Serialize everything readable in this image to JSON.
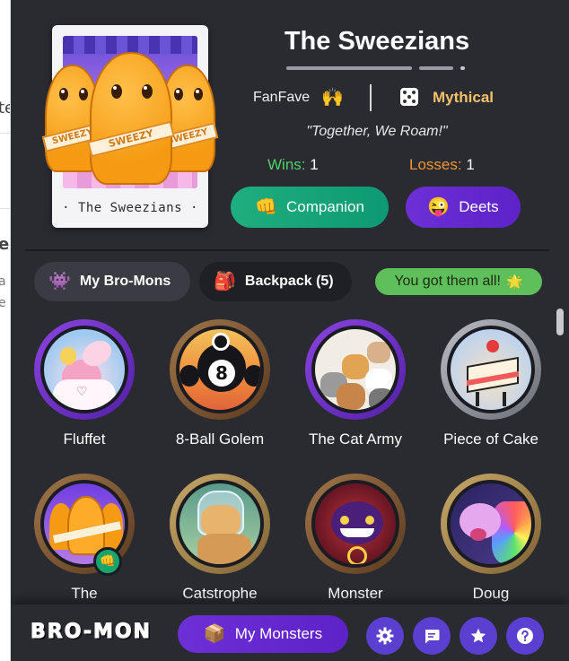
{
  "background_page": {
    "fragments": [
      "te",
      "e",
      "a",
      "e"
    ]
  },
  "header": {
    "card_caption": "· The Sweezians ·",
    "card_band_text": "SWEEZY",
    "team_name": "The Sweezians",
    "fan_label": "FanFave",
    "fan_icon": "raised-hands-emoji",
    "rarity_icon": "dice-icon",
    "rarity": "Mythical",
    "motto": "\"Together, We Roam!\"",
    "wins_label": "Wins:",
    "wins_value": "1",
    "losses_label": "Losses:",
    "losses_value": "1",
    "companion_button": "Companion",
    "deets_button": "Deets"
  },
  "tabs": {
    "my_bromons": "My Bro-Mons",
    "backpack": "Backpack (5)",
    "toast": "You got them all!"
  },
  "monsters": [
    {
      "name": "Fluffet",
      "ring": "purple"
    },
    {
      "name": "8-Ball Golem",
      "ring": "bronze"
    },
    {
      "name": "The Cat Army",
      "ring": "purple"
    },
    {
      "name": "Piece of Cake",
      "ring": "silver"
    },
    {
      "name": "The",
      "ring": "bronze",
      "badge": "fist-icon"
    },
    {
      "name": "Catstrophe",
      "ring": "gold"
    },
    {
      "name": "Monster",
      "ring": "bronze"
    },
    {
      "name": "Doug",
      "ring": "gold"
    }
  ],
  "eight_ball_number": "8",
  "footer": {
    "logo": "BRO-MON",
    "my_monsters_button": "My Monsters",
    "icons": [
      "settings-icon",
      "chat-icon",
      "star-icon",
      "help-icon"
    ]
  },
  "colors": {
    "panel_bg": "#2a2b31",
    "green_button": "#1fae7e",
    "purple_button": "#6d2fd6",
    "rarity_gold": "#f5c06a",
    "wins_green": "#4fd16a",
    "losses_orange": "#f3952f",
    "toast_green": "#5fbf5a"
  }
}
